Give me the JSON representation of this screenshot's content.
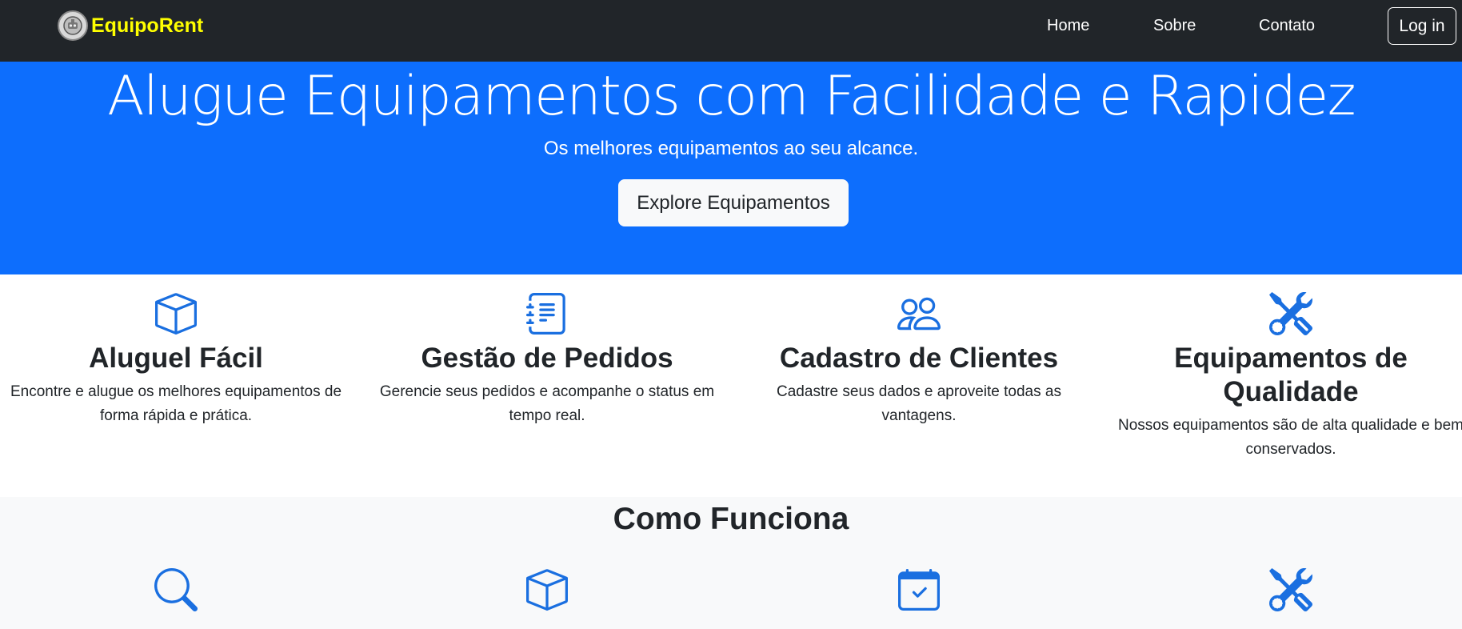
{
  "navbar": {
    "brand": "EquipoRent",
    "logo_icon": "gear-robot-icon",
    "links": [
      "Home",
      "Sobre",
      "Contato"
    ],
    "login_label": "Log in"
  },
  "hero": {
    "title": "Alugue Equipamentos com Facilidade e Rapidez",
    "subtitle": "Os melhores equipamentos ao seu alcance.",
    "cta_label": "Explore Equipamentos"
  },
  "features": [
    {
      "icon": "box-icon",
      "title": "Aluguel Fácil",
      "text": "Encontre e alugue os melhores equipamentos de forma rápida e prática."
    },
    {
      "icon": "journal-list-icon",
      "title": "Gestão de Pedidos",
      "text": "Gerencie seus pedidos e acompanhe o status em tempo real."
    },
    {
      "icon": "people-icon",
      "title": "Cadastro de Clientes",
      "text": "Cadastre seus dados e aproveite todas as vantagens."
    },
    {
      "icon": "tools-icon",
      "title": "Equipamentos de Qualidade",
      "text": "Nossos equipamentos são de alta qualidade e bem conservados."
    }
  ],
  "how_it_works": {
    "title": "Como Funciona",
    "step_icons": [
      "search-icon",
      "box-icon",
      "calendar-check-icon",
      "tools-icon"
    ]
  },
  "colors": {
    "navbar_bg": "#212529",
    "brand_text": "#ffff00",
    "hero_bg": "#0d6efd",
    "icon_blue": "#1a6fe0",
    "section_bg": "#f8f9fa"
  }
}
